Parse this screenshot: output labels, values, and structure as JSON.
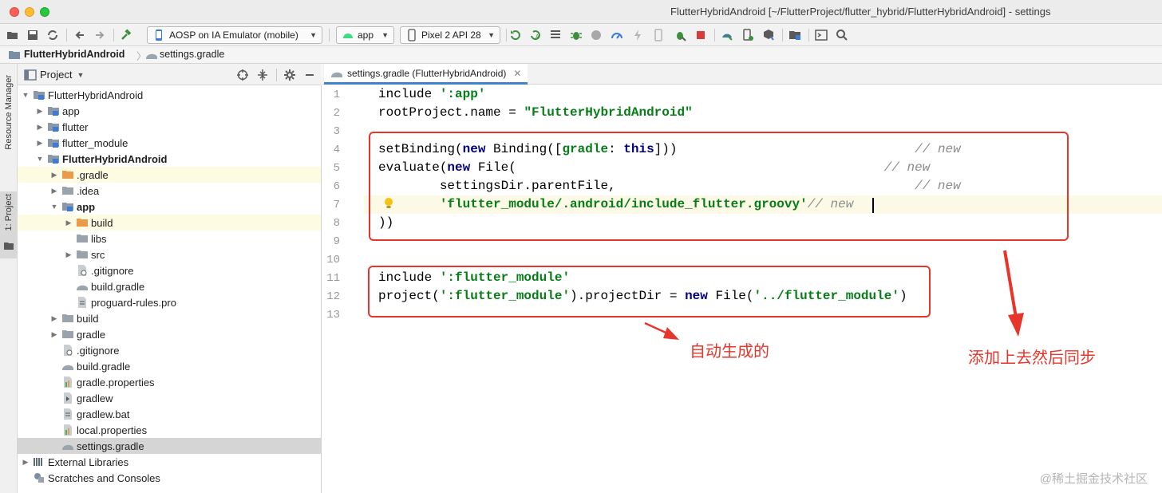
{
  "window": {
    "title": "FlutterHybridAndroid [~/FlutterProject/flutter_hybrid/FlutterHybridAndroid] - settings"
  },
  "toolbar": {
    "device_combo": "AOSP on IA Emulator (mobile)",
    "run_config": "app",
    "avd_combo": "Pixel 2 API 28"
  },
  "breadcrumb": {
    "project": "FlutterHybridAndroid",
    "file": "settings.gradle"
  },
  "left_strip": {
    "resource_manager": "Resource Manager",
    "project_tab": "1: Project"
  },
  "project_panel": {
    "view_selector": "Project",
    "tree": [
      {
        "label": "FlutterHybridAndroid",
        "depth": 0,
        "open": true,
        "icon": "module",
        "bold": false,
        "hl": false
      },
      {
        "label": "app",
        "depth": 1,
        "open": false,
        "icon": "module",
        "bold": false,
        "hl": false
      },
      {
        "label": "flutter",
        "depth": 1,
        "open": false,
        "icon": "module",
        "bold": false,
        "hl": false
      },
      {
        "label": "flutter_module",
        "depth": 1,
        "open": false,
        "icon": "module",
        "bold": false,
        "hl": false
      },
      {
        "label": "FlutterHybridAndroid",
        "depth": 1,
        "open": true,
        "icon": "module",
        "bold": true,
        "hl": false
      },
      {
        "label": ".gradle",
        "depth": 2,
        "open": false,
        "icon": "folder-orange",
        "bold": false,
        "hl": true
      },
      {
        "label": ".idea",
        "depth": 2,
        "open": false,
        "icon": "folder",
        "bold": false,
        "hl": false
      },
      {
        "label": "app",
        "depth": 2,
        "open": true,
        "icon": "module",
        "bold": true,
        "hl": false
      },
      {
        "label": "build",
        "depth": 3,
        "open": false,
        "icon": "folder-orange",
        "bold": false,
        "hl": true
      },
      {
        "label": "libs",
        "depth": 3,
        "open": null,
        "icon": "folder",
        "bold": false,
        "hl": false
      },
      {
        "label": "src",
        "depth": 3,
        "open": false,
        "icon": "folder",
        "bold": false,
        "hl": false
      },
      {
        "label": ".gitignore",
        "depth": 3,
        "open": null,
        "icon": "file-ignore",
        "bold": false,
        "hl": false
      },
      {
        "label": "build.gradle",
        "depth": 3,
        "open": null,
        "icon": "gradle",
        "bold": false,
        "hl": false
      },
      {
        "label": "proguard-rules.pro",
        "depth": 3,
        "open": null,
        "icon": "file",
        "bold": false,
        "hl": false
      },
      {
        "label": "build",
        "depth": 2,
        "open": false,
        "icon": "folder",
        "bold": false,
        "hl": false
      },
      {
        "label": "gradle",
        "depth": 2,
        "open": false,
        "icon": "folder",
        "bold": false,
        "hl": false
      },
      {
        "label": ".gitignore",
        "depth": 2,
        "open": null,
        "icon": "file-ignore",
        "bold": false,
        "hl": false
      },
      {
        "label": "build.gradle",
        "depth": 2,
        "open": null,
        "icon": "gradle",
        "bold": false,
        "hl": false
      },
      {
        "label": "gradle.properties",
        "depth": 2,
        "open": null,
        "icon": "properties",
        "bold": false,
        "hl": false
      },
      {
        "label": "gradlew",
        "depth": 2,
        "open": null,
        "icon": "exec",
        "bold": false,
        "hl": false
      },
      {
        "label": "gradlew.bat",
        "depth": 2,
        "open": null,
        "icon": "file",
        "bold": false,
        "hl": false
      },
      {
        "label": "local.properties",
        "depth": 2,
        "open": null,
        "icon": "properties",
        "bold": false,
        "hl": false
      },
      {
        "label": "settings.gradle",
        "depth": 2,
        "open": null,
        "icon": "gradle",
        "bold": false,
        "hl": false,
        "selected": true
      },
      {
        "label": "External Libraries",
        "depth": 0,
        "open": false,
        "icon": "libraries",
        "bold": false,
        "hl": false
      },
      {
        "label": "Scratches and Consoles",
        "depth": 0,
        "open": null,
        "icon": "scratches",
        "bold": false,
        "hl": false
      }
    ]
  },
  "editor": {
    "tab_label": "settings.gradle (FlutterHybridAndroid)",
    "line_numbers": [
      "1",
      "2",
      "3",
      "4",
      "5",
      "6",
      "7",
      "8",
      "9",
      "10",
      "11",
      "12",
      "13"
    ],
    "lines": [
      [
        {
          "t": "include ",
          "c": ""
        },
        {
          "t": "':app'",
          "c": "str"
        }
      ],
      [
        {
          "t": "rootProject.name = ",
          "c": ""
        },
        {
          "t": "\"FlutterHybridAndroid\"",
          "c": "str"
        }
      ],
      [],
      [
        {
          "t": "setBinding(",
          "c": ""
        },
        {
          "t": "new ",
          "c": "kw"
        },
        {
          "t": "Binding([",
          "c": ""
        },
        {
          "t": "gradle",
          "c": "str"
        },
        {
          "t": ": ",
          "c": ""
        },
        {
          "t": "this",
          "c": "kw"
        },
        {
          "t": "]))",
          "c": ""
        },
        {
          "t": "                               ",
          "c": ""
        },
        {
          "t": "// new",
          "c": "cm"
        }
      ],
      [
        {
          "t": "evaluate(",
          "c": ""
        },
        {
          "t": "new ",
          "c": "kw"
        },
        {
          "t": "File(",
          "c": ""
        },
        {
          "t": "                                                ",
          "c": ""
        },
        {
          "t": "// new",
          "c": "cm"
        }
      ],
      [
        {
          "t": "        settingsDir.parentFile,",
          "c": ""
        },
        {
          "t": "                                       ",
          "c": ""
        },
        {
          "t": "// new",
          "c": "cm"
        }
      ],
      [
        {
          "t": "        ",
          "c": ""
        },
        {
          "t": "'flutter_module/.android/include_flutter.groovy'",
          "c": "str"
        },
        {
          "t": "// new",
          "c": "cm"
        }
      ],
      [
        {
          "t": "))",
          "c": ""
        }
      ],
      [],
      [],
      [
        {
          "t": "include ",
          "c": ""
        },
        {
          "t": "':flutter_module'",
          "c": "str"
        }
      ],
      [
        {
          "t": "project(",
          "c": ""
        },
        {
          "t": "':flutter_module'",
          "c": "str"
        },
        {
          "t": ").projectDir = ",
          "c": ""
        },
        {
          "t": "new ",
          "c": "kw"
        },
        {
          "t": "File(",
          "c": ""
        },
        {
          "t": "'../flutter_module'",
          "c": "str"
        },
        {
          "t": ")",
          "c": ""
        }
      ],
      []
    ]
  },
  "annotations": {
    "auto_generated": "自动生成的",
    "add_then_sync": "添加上去然后同步"
  },
  "watermark": "@稀土掘金技术社区"
}
